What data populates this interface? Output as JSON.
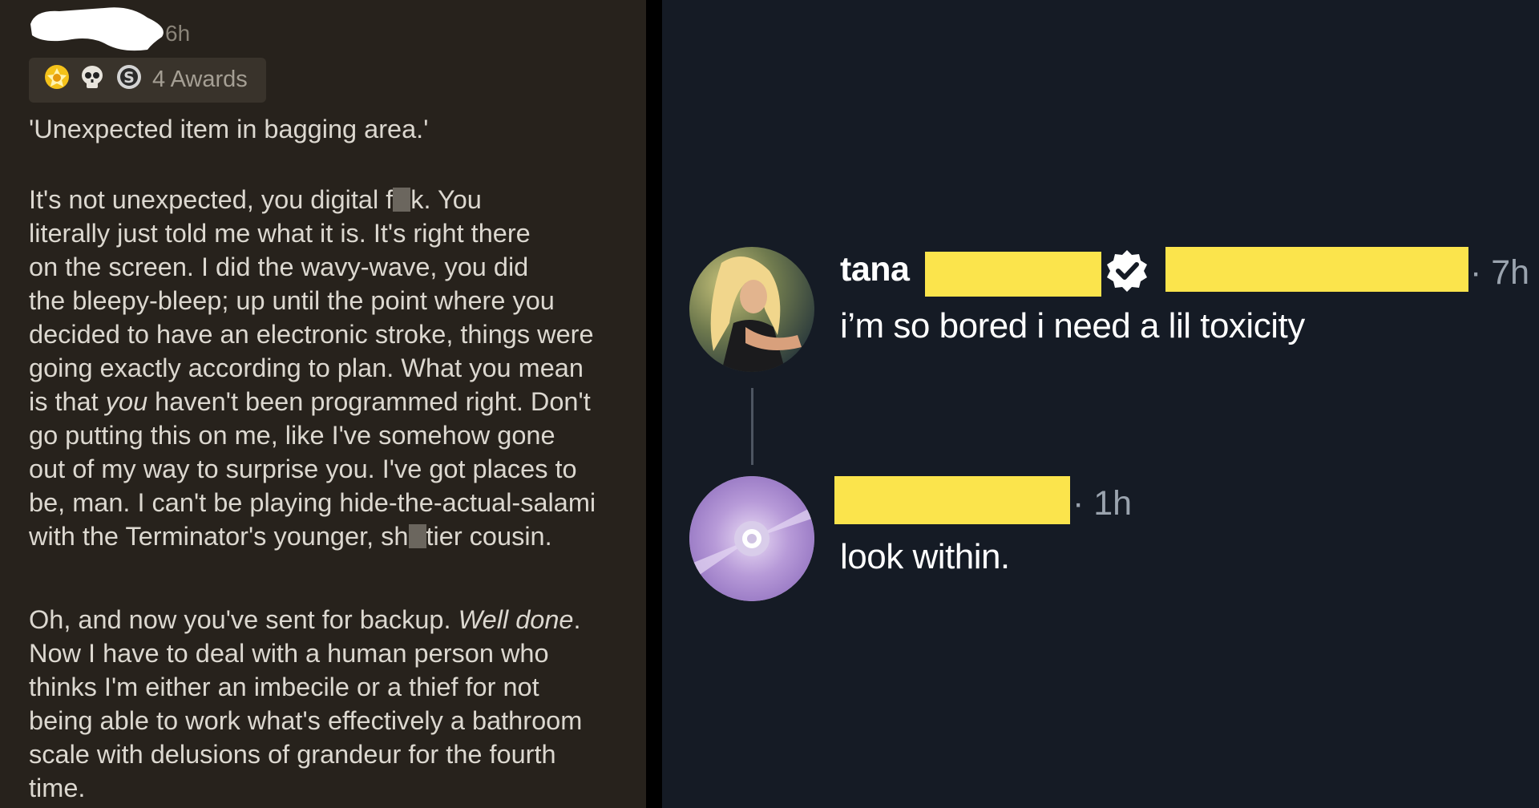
{
  "left_comment": {
    "timestamp": "6h",
    "awards_label": "4 Awards",
    "award_icons": [
      "gold-award-icon",
      "skull-award-icon",
      "silver-award-icon"
    ],
    "paragraphs": [
      {
        "lines": [
          [
            "'Unexpected item in bagging area.'"
          ]
        ]
      },
      {
        "lines": [
          [
            "It's not unexpected, you digital f",
            "[censored]",
            "k. You"
          ],
          [
            "literally just told me what it is. It's right there"
          ],
          [
            "on the screen. I did the wavy-wave, you did"
          ],
          [
            "the bleepy-bleep; up until the point where you"
          ],
          [
            "decided to have an electronic stroke, things were"
          ],
          [
            "going exactly according to plan. What you mean"
          ],
          [
            "is that ",
            {
              "em": "you"
            },
            " haven't been programmed right. Don't"
          ],
          [
            "go putting this on me, like I've somehow gone"
          ],
          [
            "out of my way to surprise you. I've got places to"
          ],
          [
            "be, man. I can't be playing hide-the-actual-salami"
          ],
          [
            "with the Terminator's younger, sh",
            "[censored]",
            "tier cousin."
          ]
        ]
      },
      {
        "lines": [
          [
            "Oh, and now you've sent for backup. ",
            {
              "em": "Well done"
            },
            "."
          ],
          [
            "Now I have to deal with a human person who"
          ],
          [
            "thinks I'm either an imbecile or a thief for not"
          ],
          [
            "being able to work what's effectively a bathroom"
          ],
          [
            "scale with delusions of grandeur for the fourth"
          ],
          [
            "time."
          ]
        ]
      }
    ]
  },
  "right_thread": {
    "post": {
      "username": "tana",
      "time": "· 7h",
      "text": "i’m so bored i need a lil toxicity"
    },
    "reply": {
      "time": "· 1h",
      "text": "look within."
    }
  },
  "colors": {
    "left_bg": "#27221c",
    "left_text": "#dcd8d0",
    "right_bg": "#151b25",
    "redaction_yellow": "#fbe44c",
    "censor_gray": "#6b665e"
  }
}
